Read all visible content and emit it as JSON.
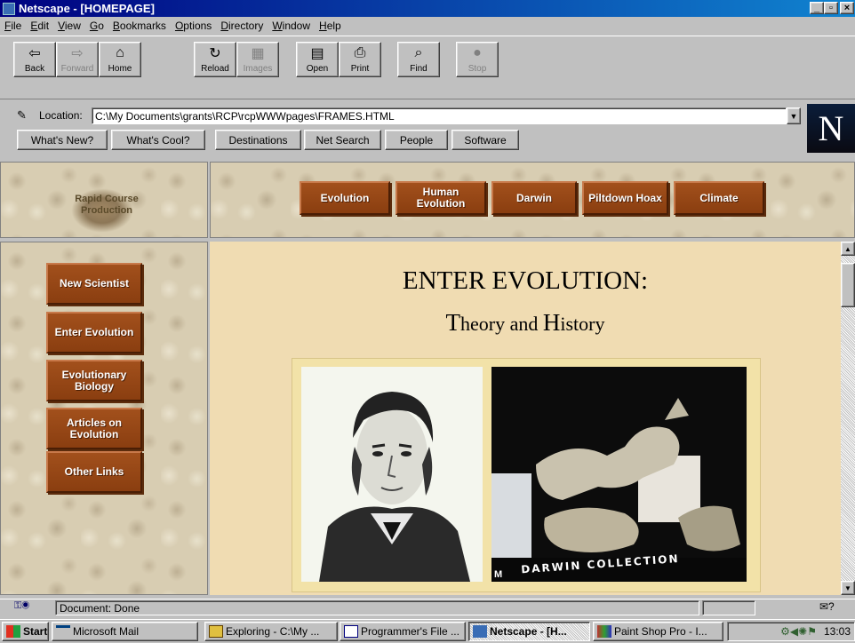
{
  "window": {
    "title": "Netscape - [HOMEPAGE]",
    "minimize": "_",
    "maximize": "▫",
    "close": "×"
  },
  "menu": [
    "File",
    "Edit",
    "View",
    "Go",
    "Bookmarks",
    "Options",
    "Directory",
    "Window",
    "Help"
  ],
  "toolbar": [
    {
      "label": "Back",
      "icon": "back-arrow-icon",
      "enabled": true
    },
    {
      "label": "Forward",
      "icon": "forward-arrow-icon",
      "enabled": false
    },
    {
      "label": "Home",
      "icon": "home-icon",
      "enabled": true
    },
    {
      "label": "Reload",
      "icon": "reload-icon",
      "enabled": true
    },
    {
      "label": "Images",
      "icon": "images-icon",
      "enabled": false
    },
    {
      "label": "Open",
      "icon": "open-icon",
      "enabled": true
    },
    {
      "label": "Print",
      "icon": "print-icon",
      "enabled": true
    },
    {
      "label": "Find",
      "icon": "find-icon",
      "enabled": true
    },
    {
      "label": "Stop",
      "icon": "stop-icon",
      "enabled": false
    }
  ],
  "location": {
    "label": "Location:",
    "value": "C:\\My Documents\\grants\\RCP\\rcpWWWpages\\FRAMES.HTML"
  },
  "directory_buttons": [
    "What's New?",
    "What's Cool?",
    "Destinations",
    "Net Search",
    "People",
    "Software"
  ],
  "netscape_logo": "N",
  "site": {
    "logo_text": "Rapid Course Production",
    "top_nav": [
      "Evolution",
      "Human Evolution",
      "Darwin",
      "Piltdown Hoax",
      "Climate"
    ],
    "side_nav": [
      "New Scientist",
      "Enter Evolution",
      "Evolutionary Biology",
      "Articles on Evolution",
      "Other Links"
    ],
    "heading": "ENTER EVOLUTION:",
    "subheading_part1": "T",
    "subheading_part2": "heory and ",
    "subheading_part3": "H",
    "subheading_part4": "istory",
    "photo_caption": "DARWIN COLLECTION",
    "photo_letter": "M"
  },
  "status": {
    "text": "Document: Done"
  },
  "taskbar": {
    "start": "Start",
    "tasks": [
      {
        "label": "Microsoft Mail",
        "active": false
      },
      {
        "label": "Exploring - C:\\My ...",
        "active": false
      },
      {
        "label": "Programmer's File ...",
        "active": false
      },
      {
        "label": "Netscape - [H...",
        "active": true
      },
      {
        "label": "Paint Shop Pro - I...",
        "active": false
      }
    ],
    "clock": "13:03"
  },
  "colors": {
    "titlebar": "#000080",
    "nav_button": "#9a4818",
    "content_bg": "#f0dcb2"
  }
}
